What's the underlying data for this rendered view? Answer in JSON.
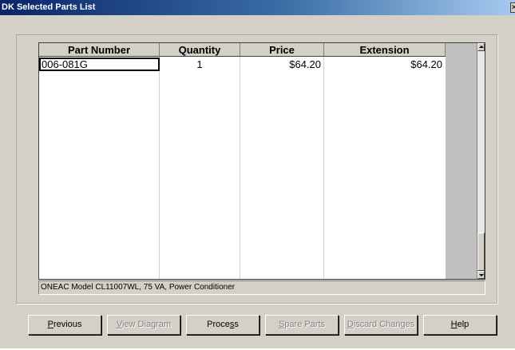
{
  "window": {
    "title": "DK Selected Parts List"
  },
  "grid": {
    "columns": [
      "Part Number",
      "Quantity",
      "Price",
      "Extension"
    ],
    "rows": [
      {
        "part_number": "006-081G",
        "quantity": "1",
        "price": "$64.20",
        "extension": "$64.20"
      }
    ]
  },
  "description": "ONEAC Model CL11007WL, 75 VA, Power Conditioner",
  "buttons": [
    {
      "pre": "",
      "mn": "P",
      "post": "revious",
      "enabled": true
    },
    {
      "pre": "",
      "mn": "V",
      "post": "iew Diagram",
      "enabled": false
    },
    {
      "pre": "Proce",
      "mn": "s",
      "post": "s",
      "enabled": true
    },
    {
      "pre": "",
      "mn": "S",
      "post": "pare Parts",
      "enabled": false
    },
    {
      "pre": "",
      "mn": "D",
      "post": "iscard Changes",
      "enabled": false
    },
    {
      "pre": "",
      "mn": "H",
      "post": "elp",
      "enabled": true
    }
  ],
  "icons": {
    "close": "close-icon",
    "scroll_up": "scroll-up-arrow-icon",
    "scroll_down": "scroll-down-arrow-icon"
  }
}
